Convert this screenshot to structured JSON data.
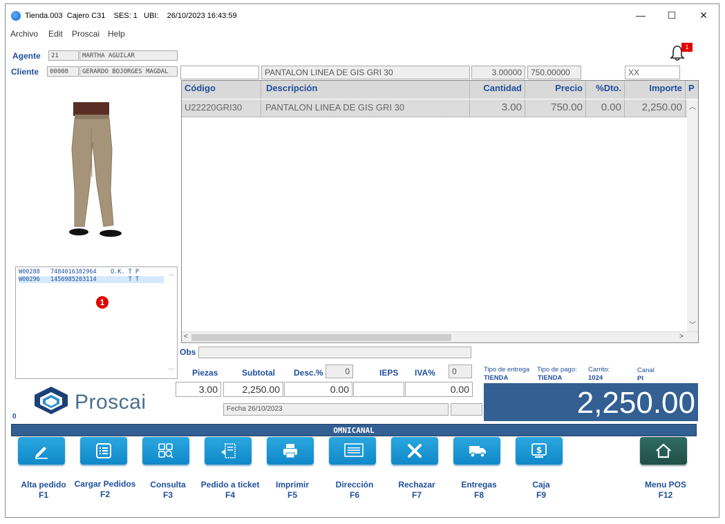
{
  "titlebar": {
    "title": "Tienda.003  Cajero C31    SES: 1   UBI:    26/10/2023 16:43:59",
    "minimize": "—",
    "maximize": "☐",
    "close": "✕"
  },
  "menu": [
    "Archivo",
    "Edit",
    "Proscai",
    "Help"
  ],
  "agent": {
    "label": "Agente",
    "code": "21",
    "name": "MARTHA AGUILAR"
  },
  "client": {
    "label": "Cliente",
    "code": "00008",
    "name": "GERARDO BOJORGES MAGDAL"
  },
  "notifications": {
    "count": "1"
  },
  "entry": {
    "code": "",
    "description": "PANTALON LINEA DE GIS GRI 30",
    "quantity": "3.00000",
    "price": "750.00000",
    "extra": "XX"
  },
  "grid": {
    "headers": [
      "Código",
      "Descripción",
      "Cantidad",
      "Precio",
      "%Dto.",
      "Importe",
      "P"
    ],
    "rows": [
      {
        "code": "U22220GRI30",
        "description": "PANTALON LINEA DE GIS GRI 30",
        "quantity": "3.00",
        "price": "750.00",
        "discount": "0.00",
        "amount": "2,250.00"
      }
    ]
  },
  "codes_list": [
    {
      "text": "W00288   7484016382964    O.K. T P"
    },
    {
      "text": "W00296   1456985203114         T T"
    }
  ],
  "marker_number": "1",
  "logo_text": "Proscai",
  "status_left": "0",
  "obs": {
    "label": "Obs",
    "value": ""
  },
  "totals": {
    "pieces_label": "Piezas",
    "subtotal_label": "Subtotal",
    "discount_label": "Desc.%",
    "discount_pct": "0",
    "ieps_label": "IEPS",
    "iva_label": "IVA%",
    "iva_pct": "0",
    "pieces": "3.00",
    "subtotal": "2,250.00",
    "discount_amount": "0.00",
    "ieps": "",
    "iva": "0.00",
    "total": "2,250.00"
  },
  "delivery": {
    "tipo_entrega_label": "Tipo de entrega",
    "tipo_entrega": "TIENDA",
    "tipo_pago_label": "Tipo de pago:",
    "tipo_pago": "TIENDA",
    "carrito_label": "Carrito:",
    "carrito": "1024",
    "canal_label": "Canal",
    "canal": "PI"
  },
  "fecha": "Fecha 26/10/2023",
  "omni_bar": "OMNICANAL",
  "function_buttons": [
    {
      "label": "Alta pedido",
      "key": "F1",
      "icon": "pencil-icon"
    },
    {
      "label": "Cargar Pedidos",
      "key": "F2",
      "icon": "list-icon"
    },
    {
      "label": "Consulta",
      "key": "F3",
      "icon": "grid-search-icon"
    },
    {
      "label": "Pedido a ticket",
      "key": "F4",
      "icon": "ticket-icon"
    },
    {
      "label": "Imprimir",
      "key": "F5",
      "icon": "printer-icon"
    },
    {
      "label": "Dirección",
      "key": "F6",
      "icon": "address-card-icon"
    },
    {
      "label": "Rechazar",
      "key": "F7",
      "icon": "x-icon"
    },
    {
      "label": "Entregas",
      "key": "F8",
      "icon": "truck-icon"
    },
    {
      "label": "Caja",
      "key": "F9",
      "icon": "cash-register-icon"
    },
    {
      "label": "Menu POS",
      "key": "F12",
      "icon": "home-icon"
    }
  ],
  "colors": {
    "accent": "#1f4e9b",
    "total_bg": "#335f93",
    "button_blue": "#1a96d4",
    "button_dark": "#2a5e57"
  }
}
